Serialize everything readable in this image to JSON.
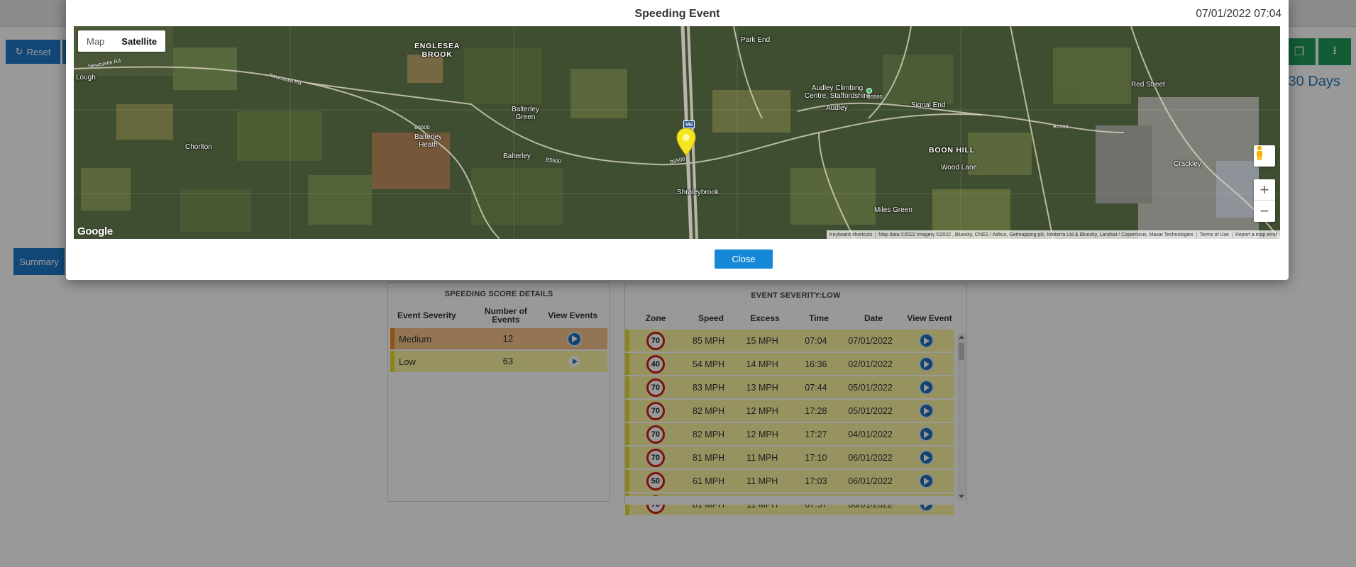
{
  "background": {
    "reset_label": "Reset",
    "summary_label": "Summary",
    "period_text": "s 30 Days",
    "copy_icon": "copy-icon",
    "download_icon": "download-icon"
  },
  "score_details": {
    "title": "SPEEDING SCORE DETAILS",
    "headers": {
      "severity": "Event Severity",
      "number": "Number of Events",
      "view": "View Events"
    },
    "rows": [
      {
        "severity": "Medium",
        "count": "12",
        "color": "#ee8a22"
      },
      {
        "severity": "Low",
        "count": "63",
        "color": "#e8dc32"
      }
    ]
  },
  "events": {
    "title": "EVENT SEVERITY:LOW",
    "headers": {
      "zone": "Zone",
      "speed": "Speed",
      "excess": "Excess",
      "time": "Time",
      "date": "Date",
      "view": "View Event"
    },
    "rows": [
      {
        "zone": "70",
        "speed": "85 MPH",
        "excess": "15 MPH",
        "time": "07:04",
        "date": "07/01/2022"
      },
      {
        "zone": "40",
        "speed": "54 MPH",
        "excess": "14 MPH",
        "time": "16:36",
        "date": "02/01/2022"
      },
      {
        "zone": "70",
        "speed": "83 MPH",
        "excess": "13 MPH",
        "time": "07:44",
        "date": "05/01/2022"
      },
      {
        "zone": "70",
        "speed": "82 MPH",
        "excess": "12 MPH",
        "time": "17:28",
        "date": "05/01/2022"
      },
      {
        "zone": "70",
        "speed": "82 MPH",
        "excess": "12 MPH",
        "time": "17:27",
        "date": "04/01/2022"
      },
      {
        "zone": "70",
        "speed": "81 MPH",
        "excess": "11 MPH",
        "time": "17:10",
        "date": "06/01/2022"
      },
      {
        "zone": "50",
        "speed": "61 MPH",
        "excess": "11 MPH",
        "time": "17:03",
        "date": "06/01/2022"
      },
      {
        "zone": "70",
        "speed": "81 MPH",
        "excess": "11 MPH",
        "time": "07:57",
        "date": "06/01/2022"
      }
    ]
  },
  "modal": {
    "title": "Speeding Event",
    "datetime": "07/01/2022 07:04",
    "close_label": "Close",
    "map": {
      "type_map": "Map",
      "type_satellite": "Satellite",
      "active_type": "Satellite",
      "google_logo": "Google",
      "attribution": {
        "shortcuts": "Keyboard shortcuts",
        "data": "Map data ©2022 Imagery ©2022 , Bluesky, CNES / Airbus, Getmapping plc, Infoterra Ltd & Bluesky, Landsat / Copernicus, Maxar Technologies",
        "terms": "Terms of Use",
        "report": "Report a map error"
      },
      "places": {
        "englesea_brook": "ENGLESEA\nBROOK",
        "park_end": "Park End",
        "audley_climbing": "Audley Climbing\nCentre, Staffordshire",
        "audley": "Audley",
        "signal_end": "Signal End",
        "red_street": "Red Street",
        "balterley_green": "Balterley\nGreen",
        "balterley_heath": "Balterley\nHeath",
        "balterley": "Balterley",
        "chorlton": "Chorlton",
        "boon_hill": "BOON HILL",
        "wood_lane": "Wood Lane",
        "crackley": "Crackley",
        "shraleybrook": "Shraleybrook",
        "miles_green": "Miles Green",
        "lough": "Lough"
      },
      "roads": {
        "newcastle_rd_1": "Newcastle Rd",
        "newcastle_rd_2": "Newcastle Rd",
        "b5500_1": "B5500",
        "b5500_2": "B5500",
        "b5500_3": "B5500",
        "b5500_4": "B5500",
        "b5500_5": "B5500",
        "m6": "M6"
      },
      "marker_color": "#f4e520"
    }
  }
}
